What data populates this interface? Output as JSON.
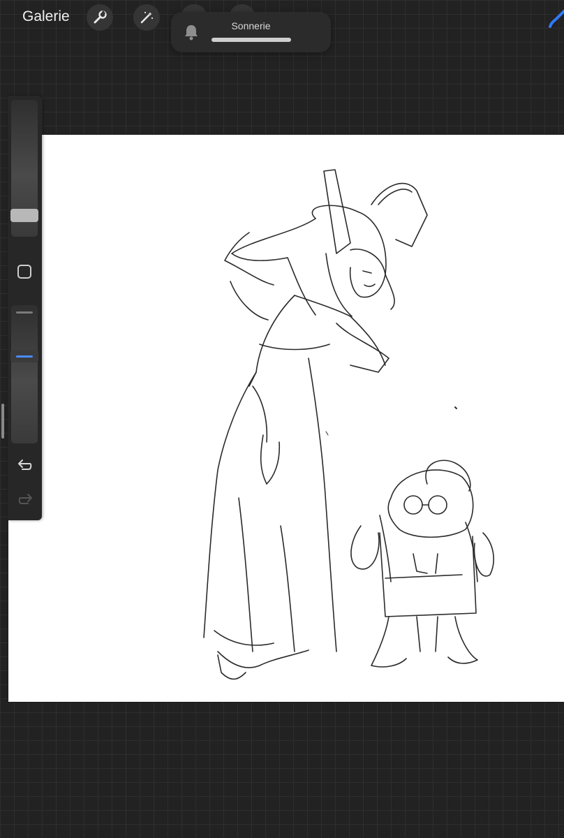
{
  "topbar": {
    "gallery_label": "Galerie",
    "tools": [
      {
        "icon": "wrench-icon"
      },
      {
        "icon": "magic-wand-icon"
      },
      {
        "icon": "selection-icon"
      },
      {
        "icon": "transform-icon"
      }
    ],
    "brush_icon": "brush-icon",
    "accent_color": "#2f7bff"
  },
  "notification": {
    "icon": "bell-icon",
    "label": "Sonnerie",
    "level": 1.0
  },
  "sidebar": {
    "size_slider": {
      "icon": "slider-handle"
    },
    "modify_button": {
      "icon": "square-icon"
    },
    "opacity_slider": {
      "icon": "slider-handle"
    },
    "undo": {
      "icon": "undo-icon"
    },
    "redo": {
      "icon": "redo-icon"
    }
  },
  "canvas": {
    "content": "pencil sketch of two characters"
  }
}
